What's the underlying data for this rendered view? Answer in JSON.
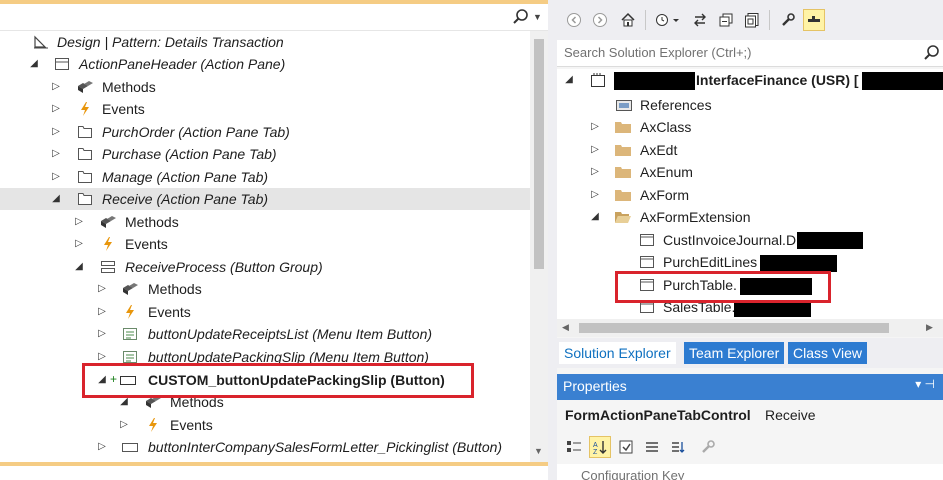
{
  "left": {
    "rows": [
      {
        "label": "Design | Pattern: Details Transaction"
      },
      {
        "label": "ActionPaneHeader (Action Pane)"
      },
      {
        "label": "Methods"
      },
      {
        "label": "Events"
      },
      {
        "label": "PurchOrder (Action Pane Tab)"
      },
      {
        "label": "Purchase (Action Pane Tab)"
      },
      {
        "label": "Manage (Action Pane Tab)"
      },
      {
        "label": "Receive (Action Pane Tab)"
      },
      {
        "label": "Methods"
      },
      {
        "label": "Events"
      },
      {
        "label": "ReceiveProcess (Button Group)"
      },
      {
        "label": "Methods"
      },
      {
        "label": "Events"
      },
      {
        "label": "buttonUpdateReceiptsList (Menu Item Button)"
      },
      {
        "label": "buttonUpdatePackingSlip (Menu Item Button)"
      },
      {
        "label": "CUSTOM_buttonUpdatePackingSlip (Button)"
      },
      {
        "label": "Methods"
      },
      {
        "label": "Events"
      },
      {
        "label": "buttonInterCompanySalesFormLetter_Pickinglist (Button)"
      }
    ]
  },
  "solution_explorer": {
    "search_placeholder": "Search Solution Explorer (Ctrl+;)",
    "project_label": "InterfaceFinance (USR) [",
    "items": [
      {
        "label": "References"
      },
      {
        "label": "AxClass"
      },
      {
        "label": "AxEdt"
      },
      {
        "label": "AxEnum"
      },
      {
        "label": "AxForm"
      },
      {
        "label": "AxFormExtension"
      },
      {
        "label": "CustInvoiceJournal.D"
      },
      {
        "label": "PurchEditLines"
      },
      {
        "label": "PurchTable."
      },
      {
        "label": "SalesTable."
      }
    ],
    "tabs": [
      {
        "label": "Solution Explorer"
      },
      {
        "label": "Team Explorer"
      },
      {
        "label": "Class View"
      }
    ]
  },
  "properties": {
    "title": "Properties",
    "header_controls": "▾ ⊣",
    "object_type": "FormActionPaneTabControl",
    "object_name": "Receive",
    "first_property": "Configuration Key"
  },
  "colors": {
    "accent_yellow": "#f5cc84",
    "highlight_red": "#d9232c",
    "properties_blue": "#3a80d1",
    "tab_blue": "#2d7bd1",
    "selected_row": "#e5e5e5"
  }
}
